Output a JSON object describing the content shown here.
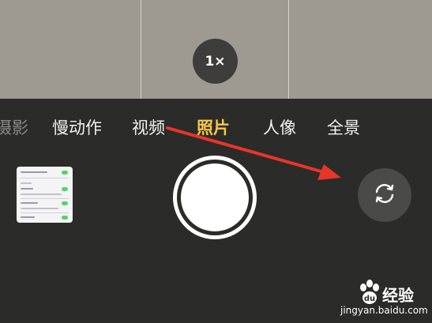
{
  "zoom": {
    "label": "1×"
  },
  "modes": [
    {
      "label": "摄影",
      "state": "faded"
    },
    {
      "label": "慢动作",
      "state": "normal"
    },
    {
      "label": "视频",
      "state": "normal"
    },
    {
      "label": "照片",
      "state": "active"
    },
    {
      "label": "人像",
      "state": "normal"
    },
    {
      "label": "全景",
      "state": "normal"
    }
  ],
  "colors": {
    "active_mode": "#f6c944",
    "annotation_arrow": "#e8352c",
    "viewfinder": "#9e9a92",
    "background": "#2b2b29"
  },
  "icons": {
    "flip": "camera-flip-icon",
    "watermark": "baidu-paw-icon"
  },
  "watermark": {
    "brand": "经验",
    "url": "jingyan.baidu.com"
  }
}
